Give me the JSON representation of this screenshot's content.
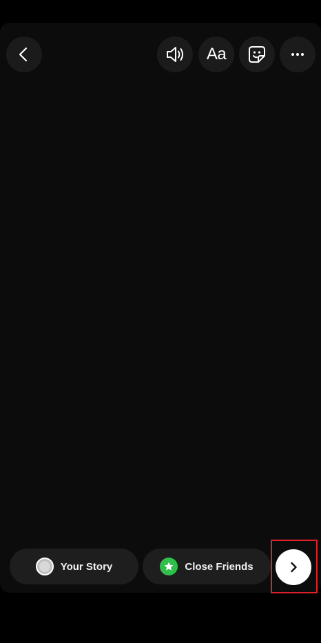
{
  "top_bar": {
    "back_icon": "chevron-left-icon",
    "sound_icon": "speaker-icon",
    "text_tool_label": "Aa",
    "sticker_icon": "sticker-icon",
    "more_icon": "more-horizontal-icon"
  },
  "share_bar": {
    "your_story_label": "Your Story",
    "close_friends_label": "Close Friends",
    "next_icon": "chevron-right-icon"
  },
  "colors": {
    "close_friends_badge": "#2fbf4a",
    "highlight": "#e0212a"
  }
}
